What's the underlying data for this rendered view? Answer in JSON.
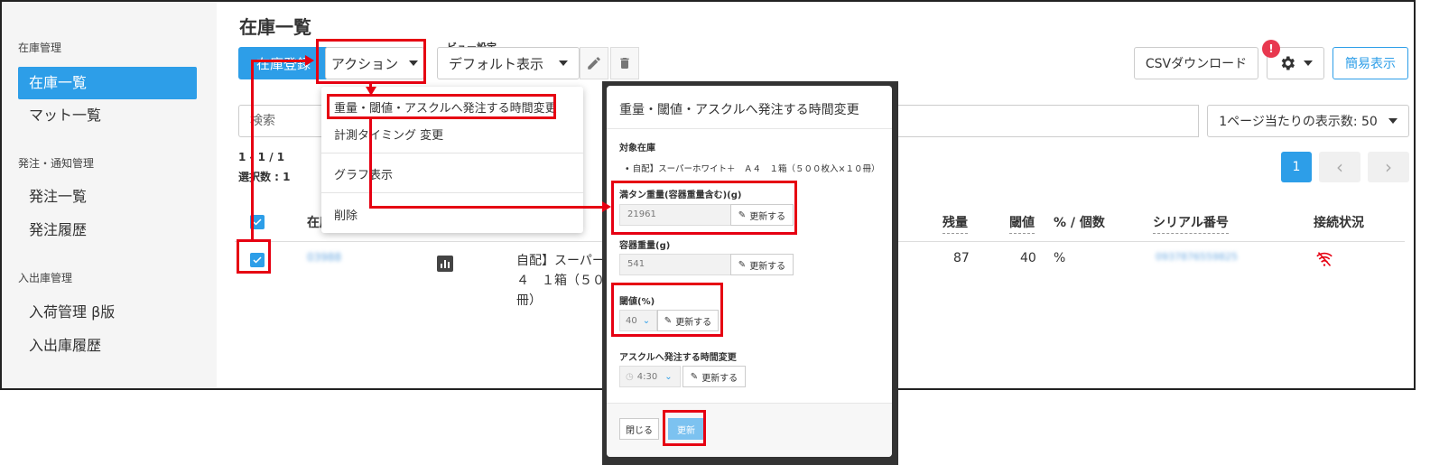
{
  "sidebar": {
    "sections": [
      {
        "title": "在庫管理",
        "items": [
          {
            "label": "在庫一覧",
            "active": true
          },
          {
            "label": "マット一覧"
          }
        ]
      },
      {
        "title": "発注・通知管理",
        "items": [
          {
            "label": "発注一覧"
          },
          {
            "label": "発注履歴"
          }
        ]
      },
      {
        "title": "入出庫管理",
        "items": [
          {
            "label": "入荷管理 β版"
          },
          {
            "label": "入出庫履歴"
          }
        ]
      }
    ]
  },
  "header": {
    "title": "在庫一覧",
    "register_label": "在庫登録",
    "action_label": "アクション",
    "view_setting_label": "ビュー設定",
    "view_select_value": "デフォルト表示",
    "csv_label": "CSVダウンロード",
    "notification_badge": "!",
    "simple_view_label": "簡易表示"
  },
  "search": {
    "placeholder": "検索"
  },
  "per_page_label": "1ページ当たりの表示数: 50",
  "counts": {
    "range": "1 - 1 / 1",
    "selected": "選択数 : 1"
  },
  "pager": {
    "current": "1",
    "prev": "‹",
    "next": "›"
  },
  "table": {
    "columns": [
      "在庫",
      "残量",
      "閾値",
      "% / 個数",
      "シリアル番号",
      "接続状況"
    ],
    "row": {
      "id": "03988",
      "name_line1": "自配】スーパー",
      "name_line2": "４　１箱（５０",
      "name_line3": "冊）",
      "remaining": "87",
      "threshold": "40",
      "unit": "%",
      "serial": "0937876559825"
    }
  },
  "dropdown": {
    "items": [
      "重量・閾値・アスクルへ発注する時間変更",
      "計測タイミング 変更",
      "グラフ表示",
      "削除"
    ]
  },
  "modal": {
    "title": "重量・閾値・アスクルへ発注する時間変更",
    "target_label": "対象在庫",
    "target_item": "• 自配】スーパーホワイト＋　Ａ４　１箱（５００枚入×１０冊）",
    "full_weight_label": "満タン重量(容器重量含む)(g)",
    "full_weight_value": "21961",
    "container_weight_label": "容器重量(g)",
    "container_weight_value": "541",
    "threshold_label": "閾値(%)",
    "threshold_value": "40",
    "order_time_label": "アスクルへ発注する時間変更",
    "order_time_value": "4:30",
    "update_btn_label": "更新する",
    "close_label": "閉じる",
    "submit_label": "更新"
  },
  "colors": {
    "accent": "#2d9ee8",
    "annotation": "#e60012",
    "badge": "#e8384f"
  }
}
